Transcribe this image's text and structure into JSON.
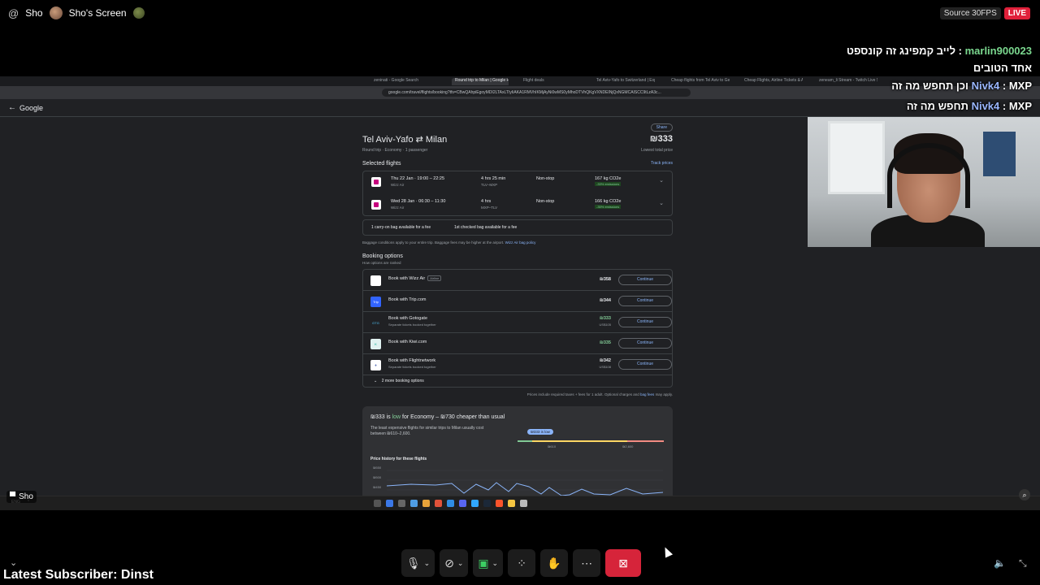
{
  "stream": {
    "at_symbol": "@",
    "host_name": "Sho",
    "screen_title": "Sho's Screen",
    "source_label": "Source 30FPS",
    "live_label": "LIVE",
    "presenter_label": "Sho",
    "latest_subscriber": "Latest Subscriber: Dinst"
  },
  "chat": [
    {
      "user": "marlin900023",
      "sep": " : ",
      "text": "לייב קמפינג זה קונספט"
    },
    {
      "user": "",
      "sep": "",
      "text": "אחד הטובים"
    },
    {
      "user": "Nivk4",
      "sep": " : ",
      "text": "MXP וכן תחפש מה זה"
    },
    {
      "user": "Nivk4",
      "sep": " : ",
      "text": "MXP תחפש מה זה"
    }
  ],
  "browser": {
    "tabs": [
      "zeninati - Google Search",
      "Round trip to Milan | Google Fli...",
      "Flight deals",
      "Tel Aviv-Yafo to Switzerland | Explore",
      "Cheap flights from Tel Aviv to Gene...",
      "Cheap Flights, Airline Tickets & Airlin...",
      "zeneam_li Stream - Twitch Live Streami..."
    ],
    "url": "google.com/travel/flights/booking?tfs=CBwQAhpiEgoyMDI2LTAxLTIyIiAKA1RMVhIKMjAyNi0wMS0yMhoDTVhQKgVXNDEINjQxNGMCAISCC9tLzA3c...",
    "back_icon": "←",
    "google_label": "Google"
  },
  "flight": {
    "share_label": "Share",
    "title": "Tel Aviv-Yafo ⇄ Milan",
    "price": "₪333",
    "trip_type": "Round trip",
    "cabin": "Economy",
    "passengers": "1 passenger",
    "lowest_label": "Lowest total price",
    "selected_label": "Selected flights",
    "track_label": "Track prices",
    "legs": [
      {
        "when": "Thu 22 Jan · 19:00 – 22:25",
        "airline": "Wizz Air",
        "duration": "4 hrs 25 min",
        "route": "TLV–MXP",
        "stops": "Non-stop",
        "co2": "167 kg CO2e",
        "emissions": "-33% emissions"
      },
      {
        "when": "Wed 28 Jan · 06:30 – 11:30",
        "airline": "Wizz Air",
        "duration": "4 hrs",
        "route": "MXP–TLV",
        "stops": "Non-stop",
        "co2": "166 kg CO2e",
        "emissions": "-35% emissions"
      }
    ],
    "bag1": "1 carry-on bag available for a fee",
    "bag2": "1st checked bag available for a fee",
    "bag_note": "Baggage conditions apply to your entire trip. Baggage fees may be higher at the airport.",
    "bag_link": "Wizz Air bag policy",
    "booking_title": "Booking options",
    "booking_sub": "How options are ranked",
    "options": [
      {
        "name": "Book with Wizz Air",
        "tag": "Airline",
        "sub": "",
        "price": "₪358",
        "usd": "",
        "btn": "Continue",
        "logo": "",
        "logo_color": "#ffffff",
        "green": false
      },
      {
        "name": "Book with Trip.com",
        "tag": "",
        "sub": "",
        "price": "₪344",
        "usd": "",
        "btn": "Continue",
        "logo": "Trip",
        "logo_color": "#3264ff",
        "green": false
      },
      {
        "name": "Book with Gotogate",
        "tag": "",
        "sub": "Separate tickets booked together",
        "price": "₪333",
        "usd": "US$105",
        "btn": "Continue",
        "logo": "GTG",
        "logo_color": "#202124",
        "green": true
      },
      {
        "name": "Book with Kiwi.com",
        "tag": "",
        "sub": "",
        "price": "₪335",
        "usd": "",
        "btn": "Continue",
        "logo": "K",
        "logo_color": "#00a991",
        "green": true
      },
      {
        "name": "Book with Flightnetwork",
        "tag": "",
        "sub": "Separate tickets booked together",
        "price": "₪342",
        "usd": "US$108",
        "btn": "Continue",
        "logo": "✈",
        "logo_color": "#1a3a9c",
        "green": false
      }
    ],
    "more_options": "2 more booking options",
    "prices_note": "Prices include required taxes + fees for 1 adult. Optional charges and",
    "prices_note_link": "bag fees",
    "prices_note_end": "may apply.",
    "insight_price": "₪333 is",
    "insight_low": "low",
    "insight_rest": "for Economy – ₪730 cheaper than usual",
    "insight_desc": "The least expensive flights for similar trips to Milan usually cost between ₪610–2,600.",
    "bubble": "₪333 is low",
    "tick1": "₪610",
    "tick2": "₪2,600",
    "history_title": "Price history for these flights",
    "y_labels": [
      "₪550",
      "₪500",
      "₪450"
    ]
  },
  "colors": {
    "live": "#e0203a",
    "link": "#8ab4f8",
    "low_green": "#81c995",
    "end_call": "#d6243a"
  },
  "icons": {
    "mic": "microphone-icon",
    "camera_off": "camera-off-icon",
    "share": "screen-share-icon",
    "apps": "apps-icon",
    "reactions": "hand-icon",
    "more": "more-icon",
    "end": "end-share-icon"
  }
}
